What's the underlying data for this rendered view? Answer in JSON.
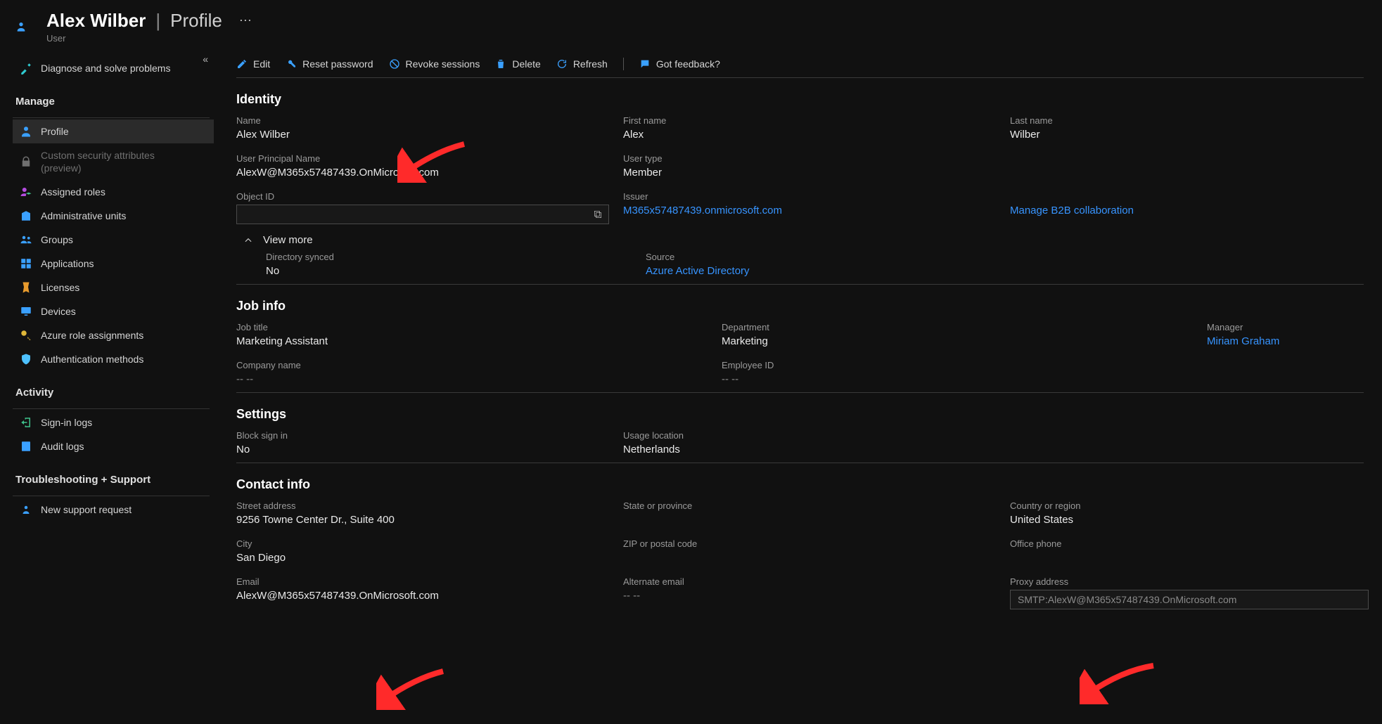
{
  "header": {
    "name": "Alex Wilber",
    "page": "Profile",
    "subtitle": "User"
  },
  "sidebar": {
    "diagnose": "Diagnose and solve problems",
    "manage_title": "Manage",
    "items": {
      "profile": "Profile",
      "csa": "Custom security attributes (preview)",
      "roles": "Assigned roles",
      "au": "Administrative units",
      "groups": "Groups",
      "apps": "Applications",
      "licenses": "Licenses",
      "devices": "Devices",
      "azrole": "Azure role assignments",
      "auth": "Authentication methods"
    },
    "activity_title": "Activity",
    "activity": {
      "signin": "Sign-in logs",
      "audit": "Audit logs"
    },
    "trouble_title": "Troubleshooting + Support",
    "trouble": {
      "support": "New support request"
    }
  },
  "toolbar": {
    "edit": "Edit",
    "reset": "Reset password",
    "revoke": "Revoke sessions",
    "delete": "Delete",
    "refresh": "Refresh",
    "feedback": "Got feedback?"
  },
  "sections": {
    "identity": "Identity",
    "jobinfo": "Job info",
    "settings": "Settings",
    "contact": "Contact info",
    "viewmore": "View more"
  },
  "identity": {
    "name_label": "Name",
    "name_value": "Alex Wilber",
    "first_label": "First name",
    "first_value": "Alex",
    "last_label": "Last name",
    "last_value": "Wilber",
    "upn_label": "User Principal Name",
    "upn_value": "AlexW@M365x57487439.OnMicrosoft.com",
    "utype_label": "User type",
    "utype_value": "Member",
    "objid_label": "Object ID",
    "issuer_label": "Issuer",
    "issuer_value": "M365x57487439.onmicrosoft.com",
    "b2b": "Manage B2B collaboration",
    "dirsync_label": "Directory synced",
    "dirsync_value": "No",
    "source_label": "Source",
    "source_value": "Azure Active Directory"
  },
  "job": {
    "title_label": "Job title",
    "title_value": "Marketing Assistant",
    "dept_label": "Department",
    "dept_value": "Marketing",
    "mgr_label": "Manager",
    "mgr_value": "Miriam Graham",
    "comp_label": "Company name",
    "comp_value": "-- --",
    "emp_label": "Employee ID",
    "emp_value": "-- --"
  },
  "settings": {
    "block_label": "Block sign in",
    "block_value": "No",
    "usage_label": "Usage location",
    "usage_value": "Netherlands"
  },
  "contact": {
    "street_label": "Street address",
    "street_value": "9256 Towne Center Dr., Suite 400",
    "state_label": "State or province",
    "country_label": "Country or region",
    "country_value": "United States",
    "city_label": "City",
    "city_value": "San Diego",
    "zip_label": "ZIP or postal code",
    "office_label": "Office phone",
    "email_label": "Email",
    "email_value": "AlexW@M365x57487439.OnMicrosoft.com",
    "alt_label": "Alternate email",
    "alt_value": "-- --",
    "proxy_label": "Proxy address",
    "proxy_value": "SMTP:AlexW@M365x57487439.OnMicrosoft.com"
  }
}
